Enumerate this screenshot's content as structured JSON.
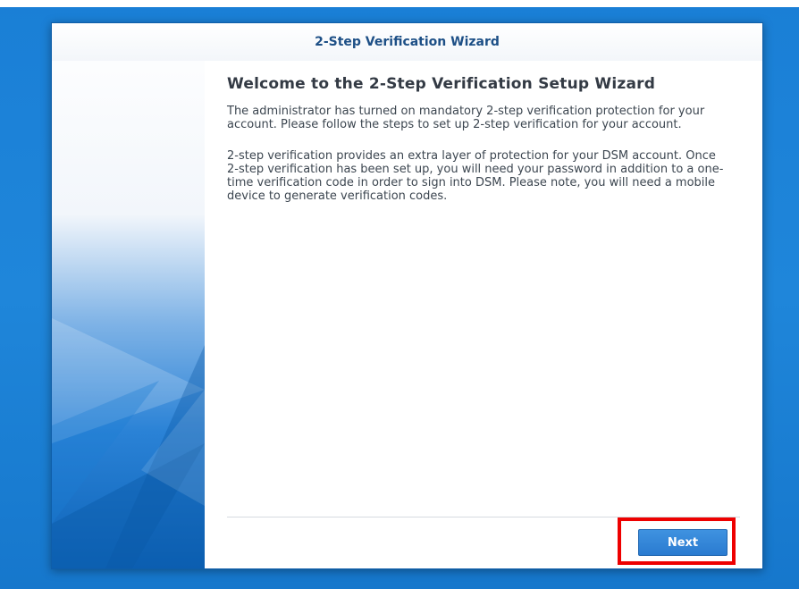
{
  "window": {
    "title": "2-Step Verification Wizard"
  },
  "content": {
    "heading": "Welcome to the 2-Step Verification Setup Wizard",
    "paragraph_1": "The administrator has turned on mandatory 2-step verification protection for your account. Please follow the steps to set up 2-step verification for your account.",
    "paragraph_2": "2-step verification provides an extra layer of protection for your DSM account. Once 2-step verification has been set up, you will need your password in addition to a one-time verification code in order to sign into DSM. Please note, you will need a mobile device to generate verification codes."
  },
  "footer": {
    "next_label": "Next"
  },
  "colors": {
    "desktop_background": "#1a7fd6",
    "title_text": "#1d4f86",
    "button_primary": "#2a7bd0",
    "highlight_outline": "#ee0000"
  }
}
